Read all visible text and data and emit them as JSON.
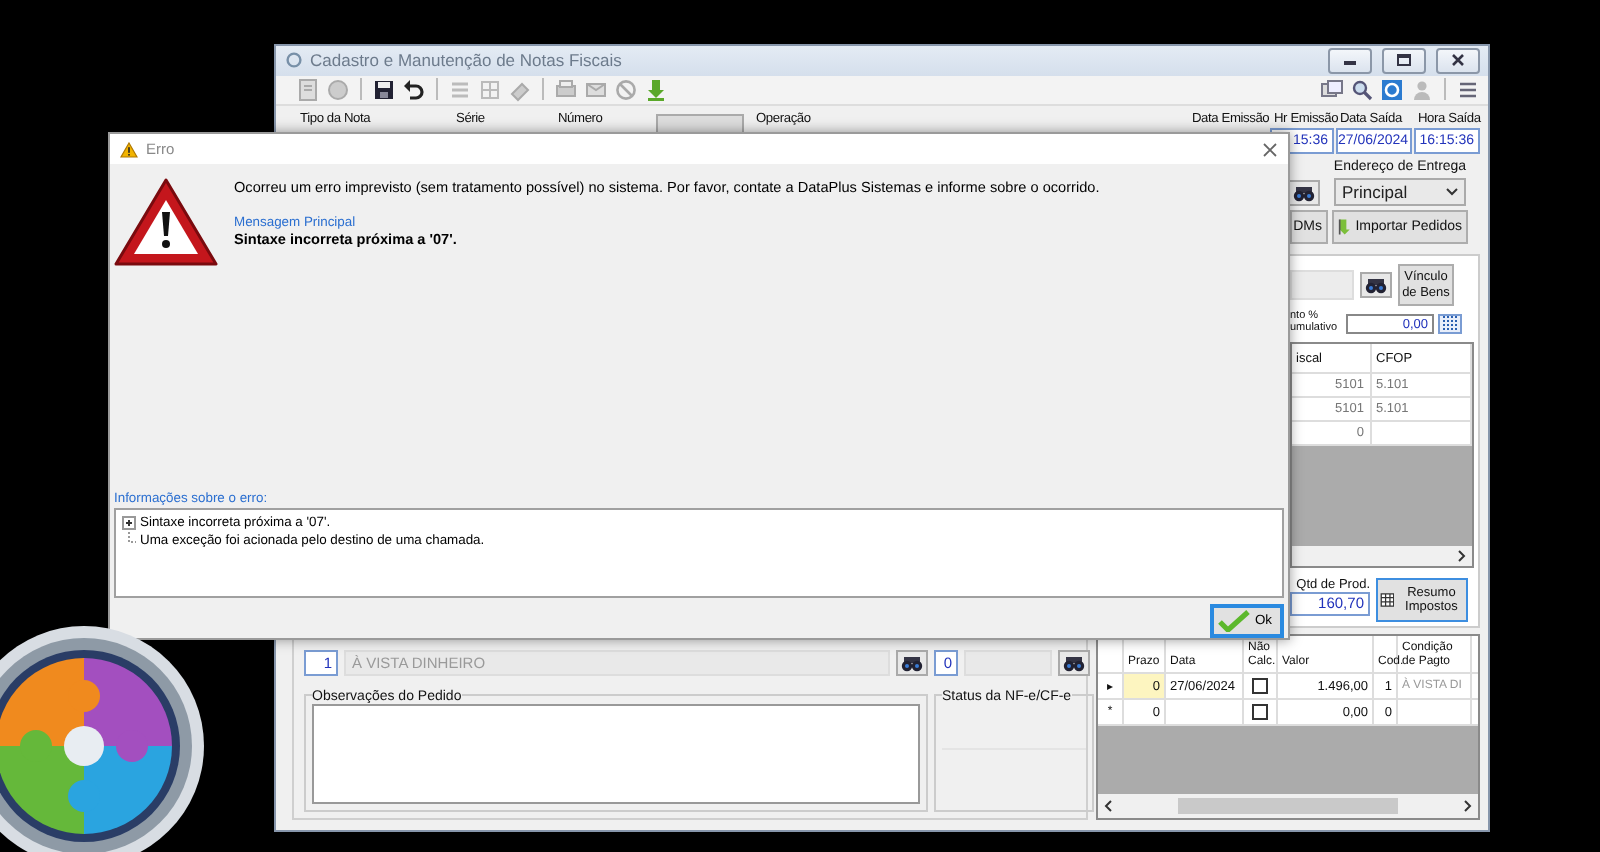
{
  "main_window": {
    "title": "Cadastro e Manutenção de Notas Fiscais",
    "header_fields": [
      {
        "label": "Tipo da Nota"
      },
      {
        "label": "Série"
      },
      {
        "label": "Número"
      },
      {
        "label": "Operação"
      },
      {
        "label": "Data Emissão"
      },
      {
        "label": "Hr Emissão",
        "value": "15:36"
      },
      {
        "label": "Data Saída",
        "value": "27/06/2024"
      },
      {
        "label": "Hora Saída",
        "value": "16:15:36"
      }
    ],
    "delivery_address": {
      "label": "Endereço de Entrega",
      "value": "Principal"
    },
    "buttons": [
      {
        "label": "DMs"
      },
      {
        "label": "Importar Pedidos"
      }
    ],
    "assets_button": {
      "label": "Vínculo de Bens"
    },
    "discount": {
      "label_lines": [
        "nto %",
        "umulativo"
      ],
      "value": "0,00"
    },
    "items_table": {
      "columns": [
        "iscal",
        "CFOP"
      ],
      "rows": [
        [
          "5101",
          "5.101"
        ],
        [
          "5101",
          "5.101"
        ],
        [
          "0"
        ]
      ]
    },
    "quantity": {
      "label": "Qtd de Prod.",
      "value": "160,70"
    },
    "taxes_button": {
      "label": "Resumo Impostos"
    },
    "payment_condition": {
      "code": "1",
      "name": "À VISTA DINHEIRO"
    },
    "card_operator": {
      "code": "0"
    },
    "notes": {
      "label": "Observações do Pedido"
    },
    "invoice_status": {
      "label": "Status da NF-e/CF-e"
    },
    "installments": {
      "columns": [
        "Prazo",
        "Data",
        "Não Calc.",
        "Valor",
        "Cod.",
        "Condição de Pagto"
      ],
      "rows": [
        {
          "marker": "▸",
          "selected": true,
          "term": "0",
          "date": "27/06/2024",
          "not_calculated": false,
          "value": "1.496,00",
          "code": "1",
          "condition": "À VISTA DI"
        },
        {
          "marker": "*",
          "selected": false,
          "term": "0",
          "not_calculated": false,
          "value": "0,00",
          "code": "0"
        }
      ]
    }
  },
  "error_dialog": {
    "title": "Erro",
    "message": "Ocorreu um erro imprevisto (sem tratamento possível) no sistema. Por favor, contate a DataPlus Sistemas e informe sobre o ocorrido.",
    "main_caption": "Mensagem Principal",
    "main_message": "Sintaxe incorreta próxima a '07'.",
    "details_caption": "Informações sobre o erro:",
    "details": [
      {
        "kind": "collapsed",
        "text": "Sintaxe incorreta próxima a '07'."
      },
      {
        "kind": "leaf",
        "text": "Uma exceção foi acionada pelo destino de uma chamada."
      }
    ],
    "ok_button": "Ok"
  }
}
